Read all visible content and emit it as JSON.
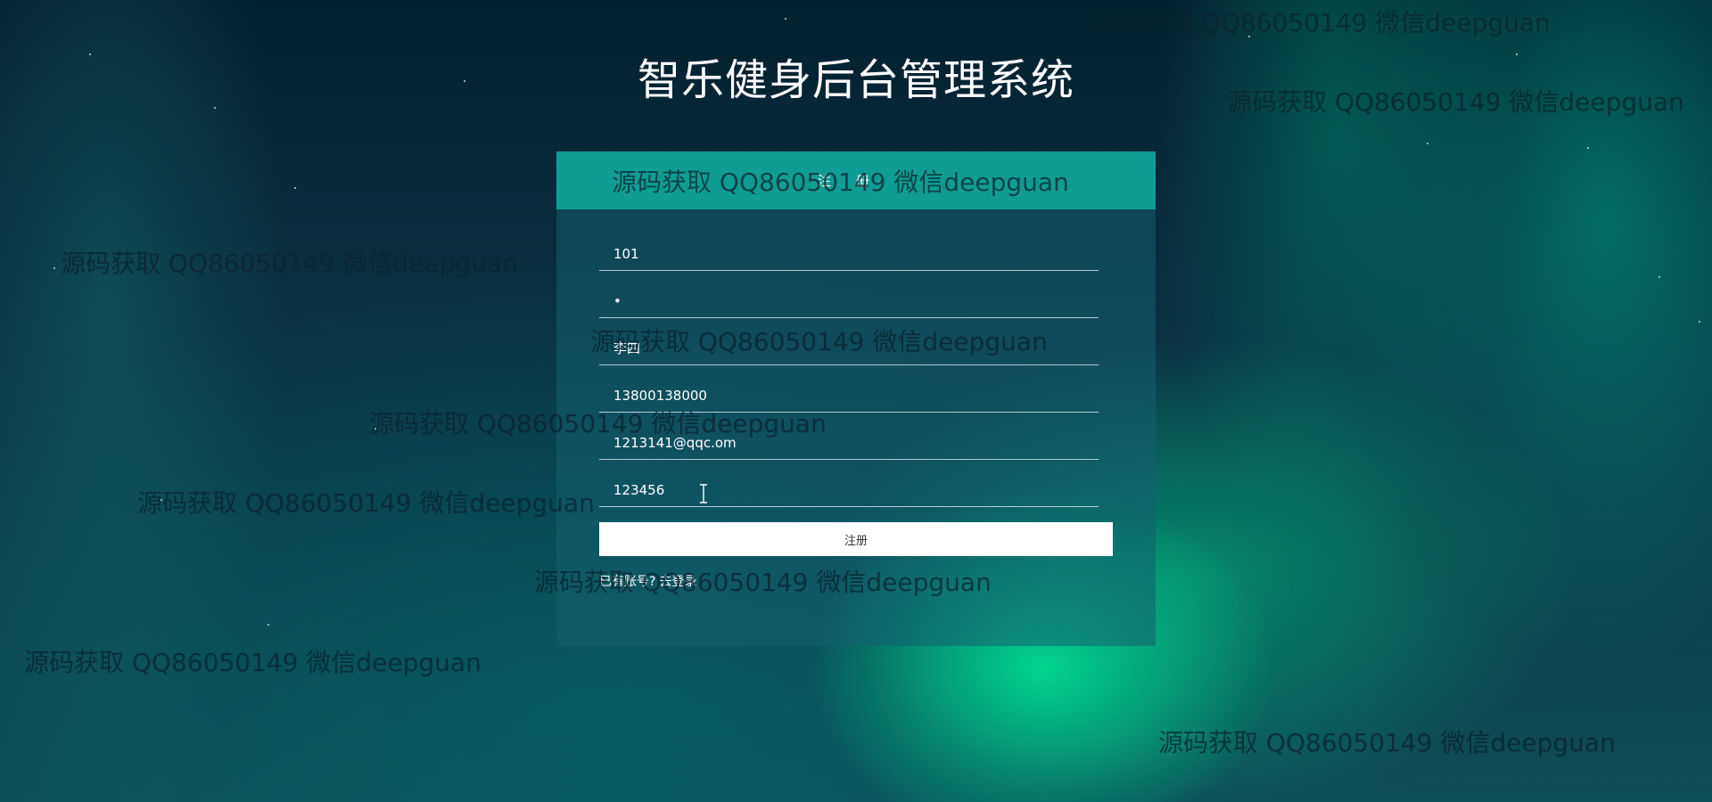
{
  "page_title": "智乐健身后台管理系统",
  "register_form": {
    "header": "注册",
    "fields": [
      {
        "name": "account",
        "value": "101"
      },
      {
        "name": "password",
        "value": "•"
      },
      {
        "name": "name",
        "value": "李四"
      },
      {
        "name": "phone",
        "value": "13800138000"
      },
      {
        "name": "email",
        "value": "1213141@qqc.om"
      },
      {
        "name": "confirm",
        "value": "123456"
      }
    ],
    "submit_label": "注册",
    "has_account_text": "已有账号?",
    "login_link_label": "去登录"
  },
  "watermark_text": "源码获取 QQ86050149 微信deepguan",
  "colors": {
    "header": "#0f9c94",
    "button": "#ffffff",
    "title": "#ffffff"
  }
}
